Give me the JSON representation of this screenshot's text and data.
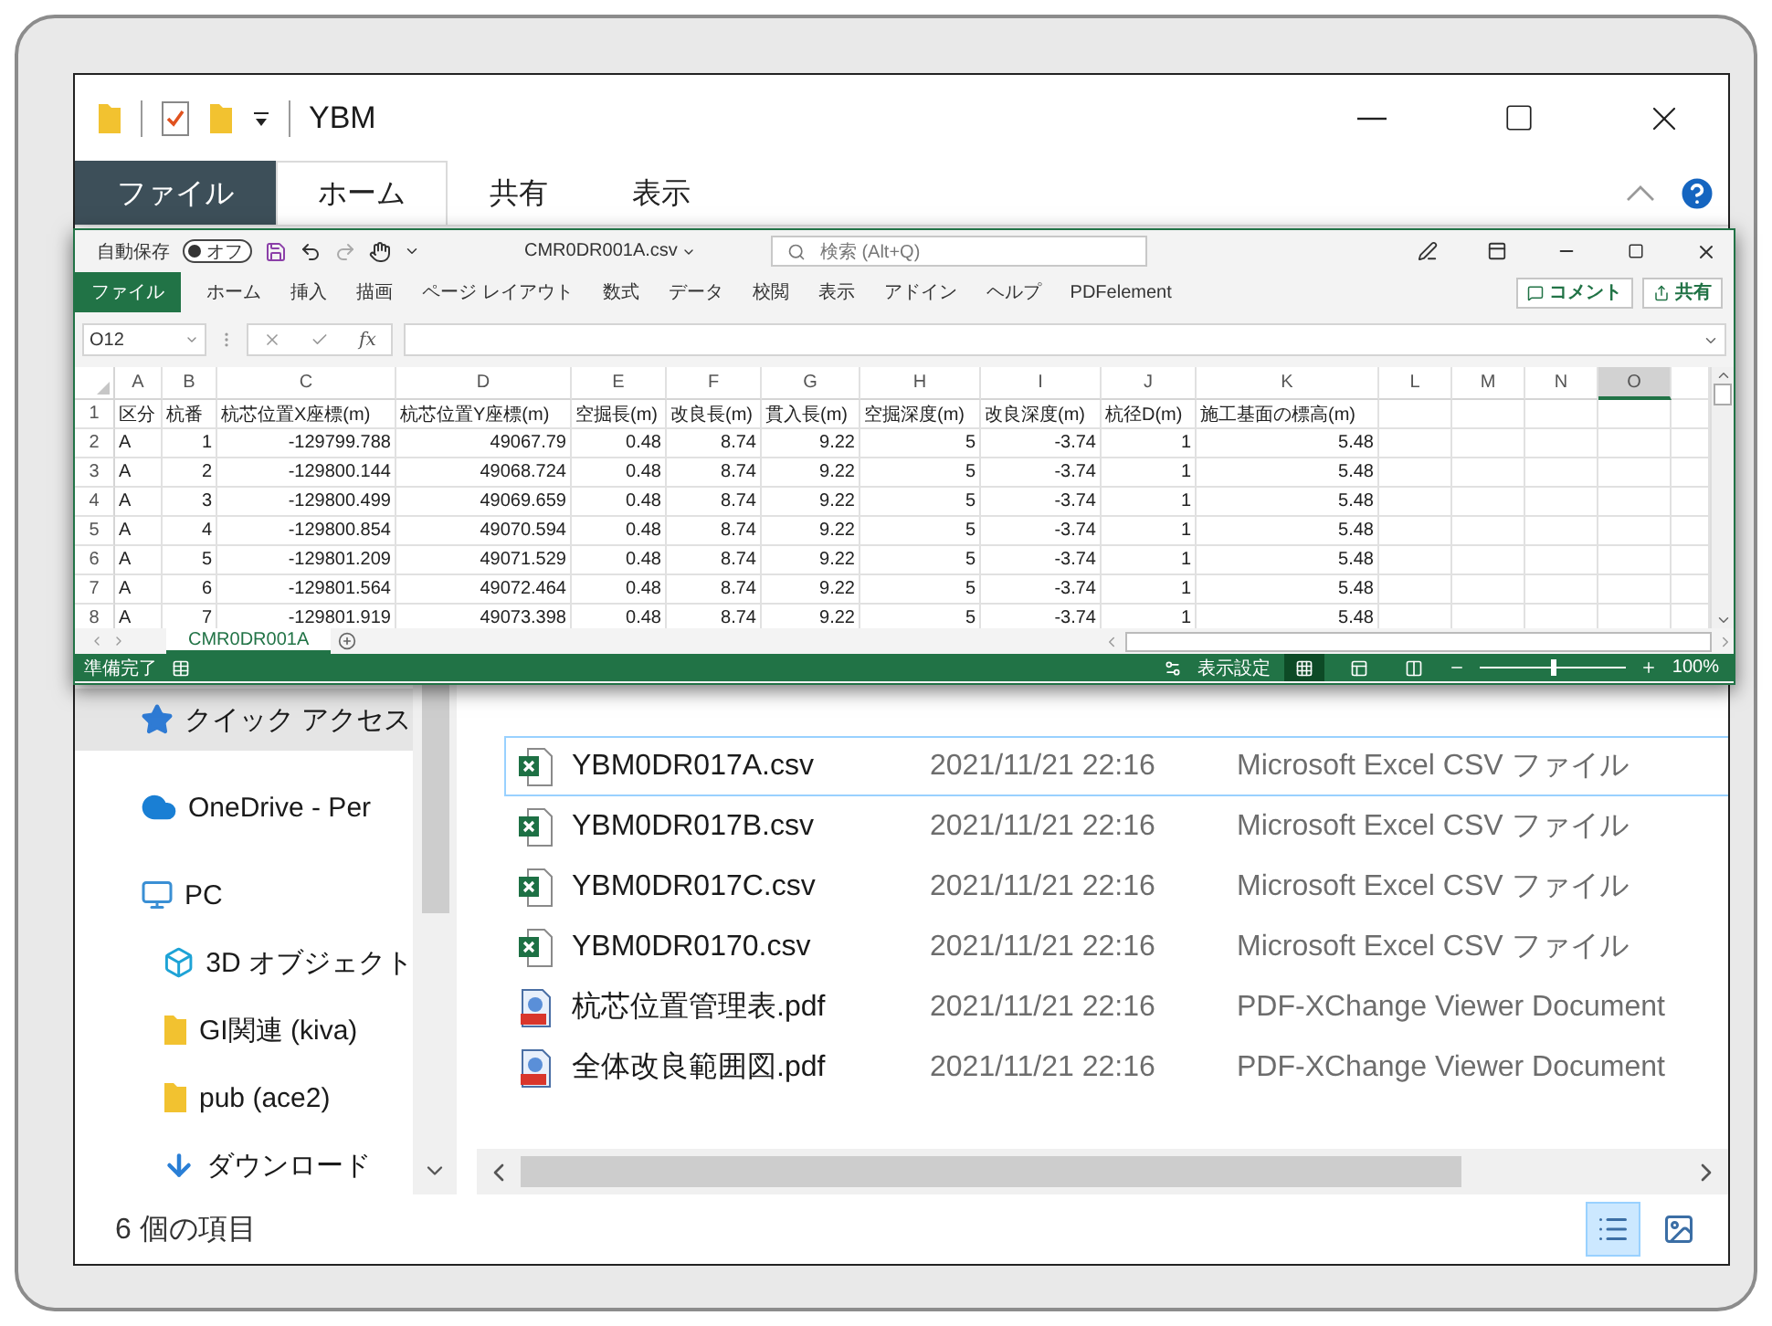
{
  "explorer": {
    "title": "YBM",
    "ribbon_tabs": [
      {
        "label": "ファイル",
        "kind": "file",
        "selected": false
      },
      {
        "label": "ホーム",
        "kind": "tab",
        "selected": true
      },
      {
        "label": "共有",
        "kind": "tab",
        "selected": false
      },
      {
        "label": "表示",
        "kind": "tab",
        "selected": false
      }
    ],
    "navigation": [
      {
        "label": "クイック アクセス",
        "kind": "star",
        "selected": true
      },
      {
        "label": "OneDrive - Per",
        "kind": "cloud",
        "selected": false
      },
      {
        "label": "PC",
        "kind": "pc",
        "selected": false,
        "children": [
          {
            "label": "3D オブジェクト",
            "kind": "cube",
            "selected": false
          },
          {
            "label": "GI関連 (kiva)",
            "kind": "folder",
            "selected": false
          },
          {
            "label": "pub (ace2)",
            "kind": "folder",
            "selected": false
          },
          {
            "label": "ダウンロード",
            "kind": "download",
            "selected": false
          }
        ]
      }
    ],
    "files": [
      {
        "name": "YBM0DR017A.csv",
        "modified": "2021/11/21 22:16",
        "type": "Microsoft Excel CSV ファイル",
        "kind": "csv",
        "selected": true
      },
      {
        "name": "YBM0DR017B.csv",
        "modified": "2021/11/21 22:16",
        "type": "Microsoft Excel CSV ファイル",
        "kind": "csv",
        "selected": false
      },
      {
        "name": "YBM0DR017C.csv",
        "modified": "2021/11/21 22:16",
        "type": "Microsoft Excel CSV ファイル",
        "kind": "csv",
        "selected": false
      },
      {
        "name": "YBM0DR0170.csv",
        "modified": "2021/11/21 22:16",
        "type": "Microsoft Excel CSV ファイル",
        "kind": "csv",
        "selected": false
      },
      {
        "name": "杭芯位置管理表.pdf",
        "modified": "2021/11/21 22:16",
        "type": "PDF-XChange Viewer Document",
        "kind": "pdf",
        "selected": false
      },
      {
        "name": "全体改良範囲図.pdf",
        "modified": "2021/11/21 22:16",
        "type": "PDF-XChange Viewer Document",
        "kind": "pdf",
        "selected": false
      }
    ],
    "status": "6 個の項目",
    "views": [
      {
        "kind": "details",
        "selected": true
      },
      {
        "kind": "tiles",
        "selected": false
      }
    ]
  },
  "excel": {
    "autosave": {
      "label": "自動保存",
      "state_label": "オフ",
      "on": false
    },
    "file_name": "CMR0DR001A.csv",
    "search_placeholder": "検索 (Alt+Q)",
    "tabs": [
      {
        "label": "ファイル",
        "kind": "file"
      },
      {
        "label": "ホーム",
        "kind": "tab"
      },
      {
        "label": "挿入",
        "kind": "tab"
      },
      {
        "label": "描画",
        "kind": "tab"
      },
      {
        "label": "ページ レイアウト",
        "kind": "tab"
      },
      {
        "label": "数式",
        "kind": "tab"
      },
      {
        "label": "データ",
        "kind": "tab"
      },
      {
        "label": "校閲",
        "kind": "tab"
      },
      {
        "label": "表示",
        "kind": "tab"
      },
      {
        "label": "アドイン",
        "kind": "tab"
      },
      {
        "label": "ヘルプ",
        "kind": "tab"
      },
      {
        "label": "PDFelement",
        "kind": "tab"
      }
    ],
    "actions": [
      {
        "label": "コメント",
        "kind": "comment"
      },
      {
        "label": "共有",
        "kind": "share"
      }
    ],
    "name_box": "O12",
    "function_label": "fx",
    "columns": [
      {
        "label": "A",
        "selected": false
      },
      {
        "label": "B",
        "selected": false
      },
      {
        "label": "C",
        "selected": false
      },
      {
        "label": "D",
        "selected": false
      },
      {
        "label": "E",
        "selected": false
      },
      {
        "label": "F",
        "selected": false
      },
      {
        "label": "G",
        "selected": false
      },
      {
        "label": "H",
        "selected": false
      },
      {
        "label": "I",
        "selected": false
      },
      {
        "label": "J",
        "selected": false
      },
      {
        "label": "K",
        "selected": false
      },
      {
        "label": "L",
        "selected": false
      },
      {
        "label": "M",
        "selected": false
      },
      {
        "label": "N",
        "selected": false
      },
      {
        "label": "O",
        "selected": true
      }
    ],
    "rows": [
      {
        "number": "1",
        "kind": "header",
        "cells": [
          "区分",
          "杭番",
          "杭芯位置X座標(m)",
          "杭芯位置Y座標(m)",
          "空掘長(m)",
          "改良長(m)",
          "貫入長(m)",
          "空掘深度(m)",
          "改良深度(m)",
          "杭径D(m)",
          "施工基面の標高(m)"
        ]
      },
      {
        "number": "2",
        "kind": "data",
        "cells": [
          "A",
          "1",
          "-129799.788",
          "49067.79",
          "0.48",
          "8.74",
          "9.22",
          "5",
          "-3.74",
          "1",
          "5.48"
        ]
      },
      {
        "number": "3",
        "kind": "data",
        "cells": [
          "A",
          "2",
          "-129800.144",
          "49068.724",
          "0.48",
          "8.74",
          "9.22",
          "5",
          "-3.74",
          "1",
          "5.48"
        ]
      },
      {
        "number": "4",
        "kind": "data",
        "cells": [
          "A",
          "3",
          "-129800.499",
          "49069.659",
          "0.48",
          "8.74",
          "9.22",
          "5",
          "-3.74",
          "1",
          "5.48"
        ]
      },
      {
        "number": "5",
        "kind": "data",
        "cells": [
          "A",
          "4",
          "-129800.854",
          "49070.594",
          "0.48",
          "8.74",
          "9.22",
          "5",
          "-3.74",
          "1",
          "5.48"
        ]
      },
      {
        "number": "6",
        "kind": "data",
        "cells": [
          "A",
          "5",
          "-129801.209",
          "49071.529",
          "0.48",
          "8.74",
          "9.22",
          "5",
          "-3.74",
          "1",
          "5.48"
        ]
      },
      {
        "number": "7",
        "kind": "data",
        "cells": [
          "A",
          "6",
          "-129801.564",
          "49072.464",
          "0.48",
          "8.74",
          "9.22",
          "5",
          "-3.74",
          "1",
          "5.48"
        ]
      },
      {
        "number": "8",
        "kind": "data",
        "cells": [
          "A",
          "7",
          "-129801.919",
          "49073.398",
          "0.48",
          "8.74",
          "9.22",
          "5",
          "-3.74",
          "1",
          "5.48"
        ]
      }
    ],
    "sheets": [
      {
        "label": "CMR0DR001A",
        "selected": true
      }
    ],
    "status": "準備完了",
    "display_settings": "表示設定",
    "views": [
      {
        "kind": "normal",
        "selected": true
      },
      {
        "kind": "page_layout",
        "selected": false
      },
      {
        "kind": "page_break",
        "selected": false
      }
    ],
    "zoom": {
      "level": 0.5,
      "label": "100%"
    }
  }
}
